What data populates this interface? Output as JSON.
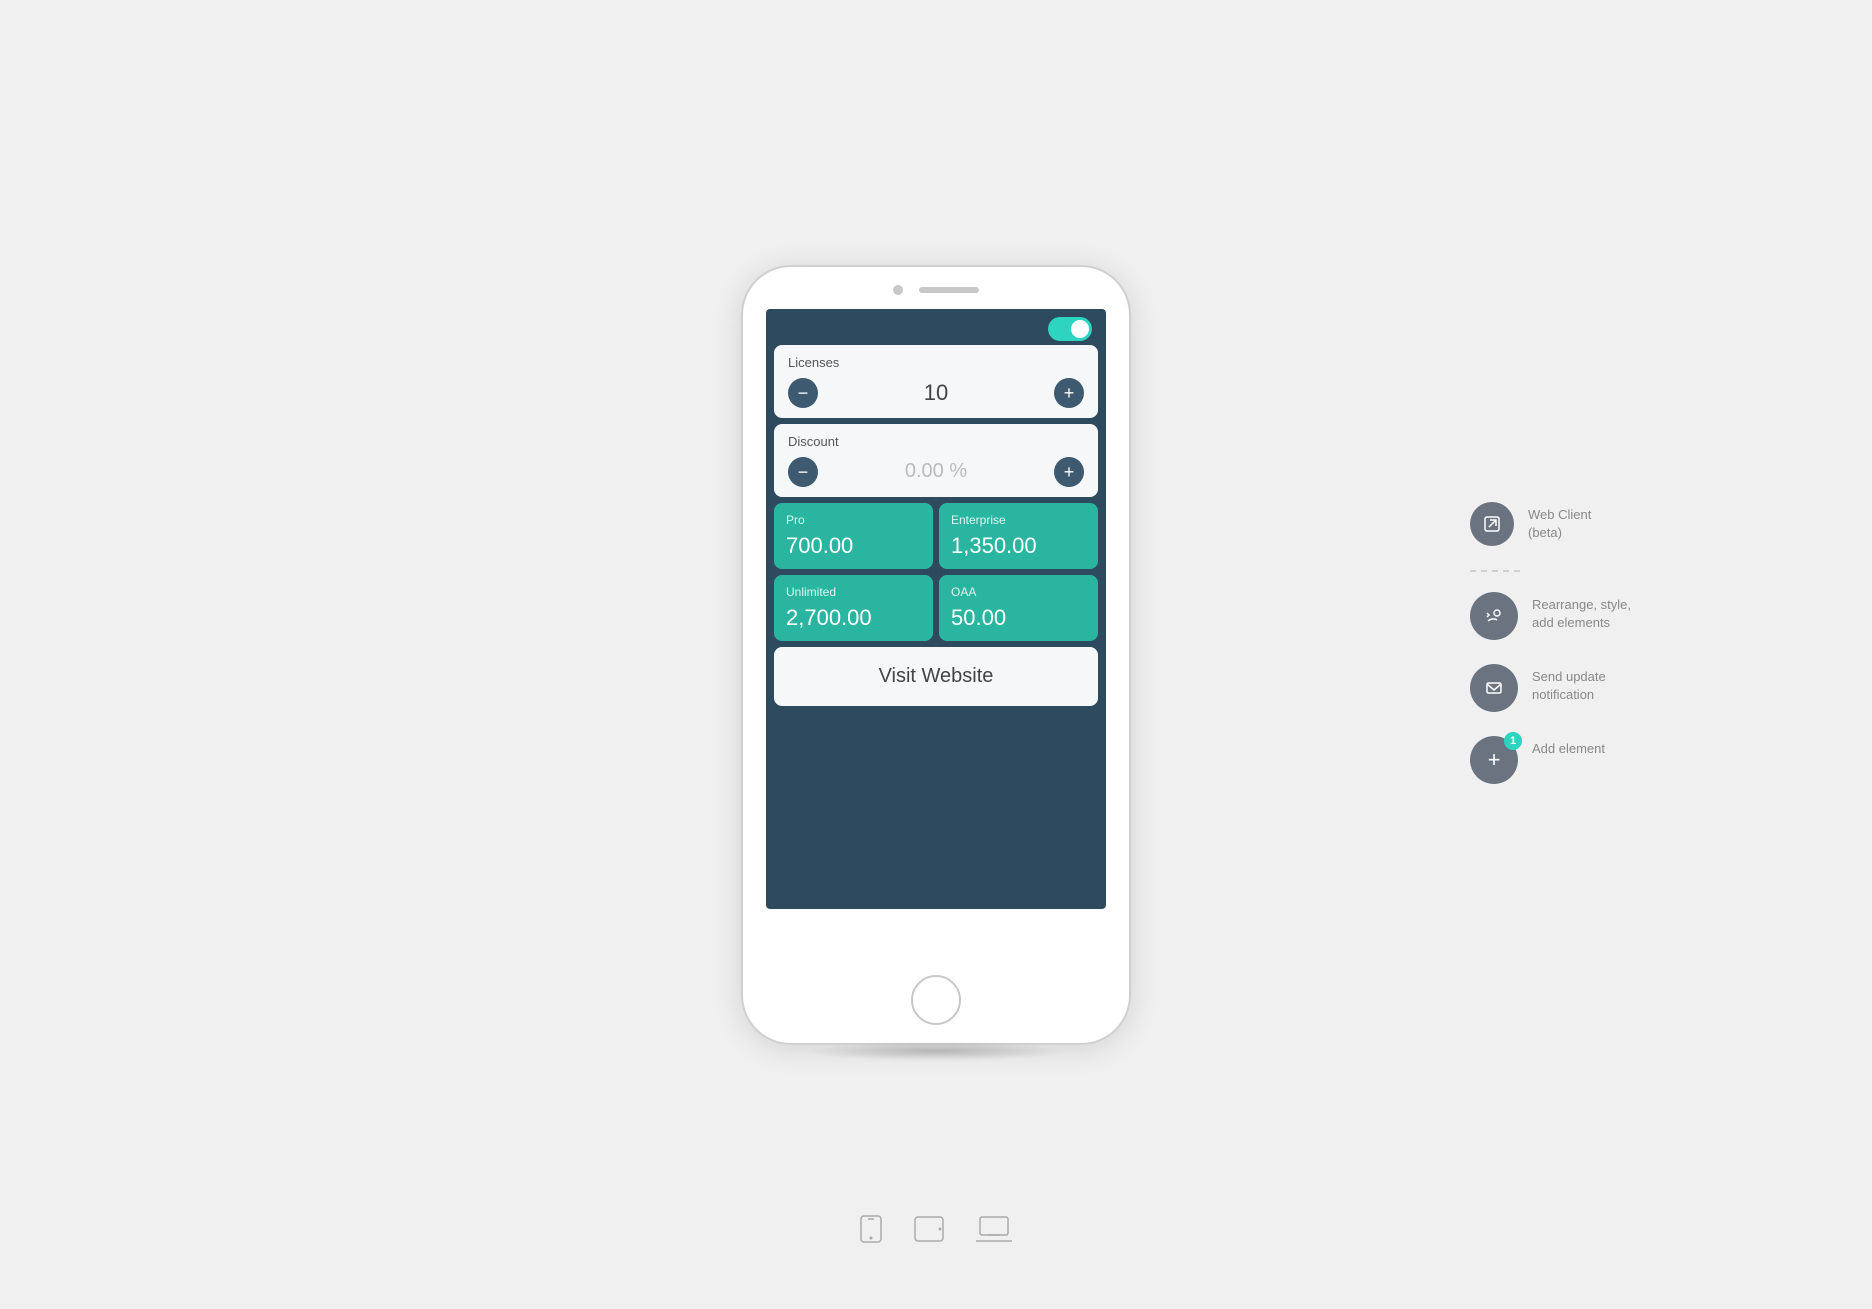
{
  "phone": {
    "licenses_label": "Licenses",
    "licenses_value": "10",
    "discount_label": "Discount",
    "discount_value": "0.00 %",
    "pricing": [
      {
        "label": "Pro",
        "value": "700.00"
      },
      {
        "label": "Enterprise",
        "value": "1,350.00"
      },
      {
        "label": "Unlimited",
        "value": "2,700.00"
      },
      {
        "label": "OAA",
        "value": "50.00"
      }
    ],
    "visit_website_label": "Visit Website"
  },
  "actions": [
    {
      "id": "web-client",
      "icon": "↗",
      "label": "Web Client (beta)",
      "badge": null
    },
    {
      "id": "rearrange",
      "icon": "🔧",
      "label": "Rearrange, style, add elements",
      "badge": null
    },
    {
      "id": "send-notification",
      "icon": "✉",
      "label": "Send update notification",
      "badge": null
    },
    {
      "id": "add-element",
      "icon": "+",
      "label": "Add element",
      "badge": "1"
    }
  ],
  "device_icons": [
    "phone",
    "tablet",
    "laptop"
  ],
  "colors": {
    "teal": "#2ab5a0",
    "dark_blue": "#2d4a5e",
    "light_bg": "#f5f7f8",
    "icon_bg": "#6b7280"
  }
}
